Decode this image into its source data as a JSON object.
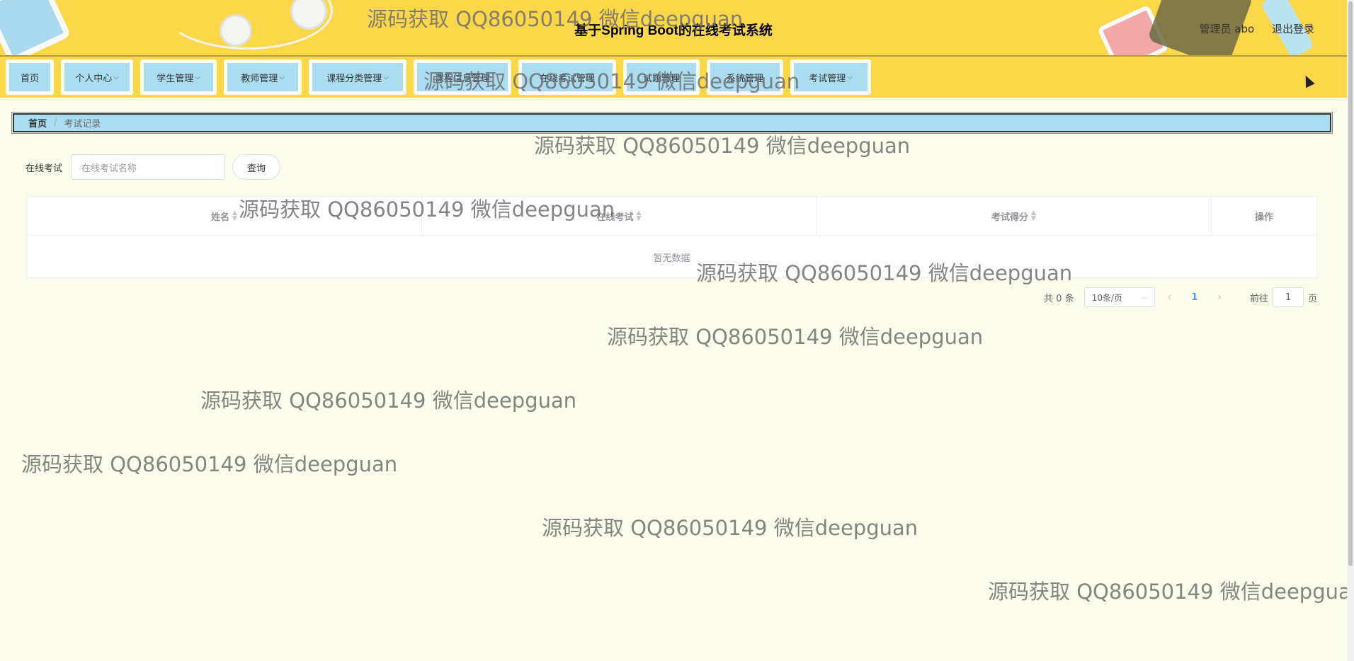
{
  "header": {
    "title": "基于Spring Boot的在线考试系统",
    "user_label": "管理员 abo",
    "logout": "退出登录"
  },
  "nav": {
    "items": [
      {
        "label": "首页",
        "has_dropdown": false
      },
      {
        "label": "个人中心",
        "has_dropdown": true
      },
      {
        "label": "学生管理",
        "has_dropdown": true
      },
      {
        "label": "教师管理",
        "has_dropdown": true
      },
      {
        "label": "课程分类管理",
        "has_dropdown": true
      },
      {
        "label": "课程信息管理",
        "has_dropdown": false
      },
      {
        "label": "在线考试管理",
        "has_dropdown": false
      },
      {
        "label": "试题管理",
        "has_dropdown": false
      },
      {
        "label": "系统管理",
        "has_dropdown": false
      },
      {
        "label": "考试管理",
        "has_dropdown": true
      }
    ]
  },
  "breadcrumb": {
    "home": "首页",
    "separator": "/",
    "current": "考试记录"
  },
  "search": {
    "label": "在线考试",
    "placeholder": "在线考试名称",
    "button": "查询"
  },
  "table": {
    "columns": [
      "姓名",
      "在线考试",
      "考试得分",
      "操作"
    ],
    "empty_text": "暂无数据"
  },
  "pagination": {
    "total": "共 0 条",
    "page_size": "10条/页",
    "prev_icon": "chevron-left-icon",
    "current_page": "1",
    "next_icon": "chevron-right-icon",
    "goto_label": "前往",
    "goto_value": "1",
    "goto_suffix": "页"
  },
  "watermark": {
    "text": "源码获取 QQ86050149 微信deepguan",
    "text_cut": "源码获取 QQ86050149 微信deepgua"
  },
  "colors": {
    "header_bg": "#fcd74a",
    "nav_button_bg": "#aadcf2",
    "page_bg": "#fdfdee",
    "link_active": "#409eff"
  }
}
